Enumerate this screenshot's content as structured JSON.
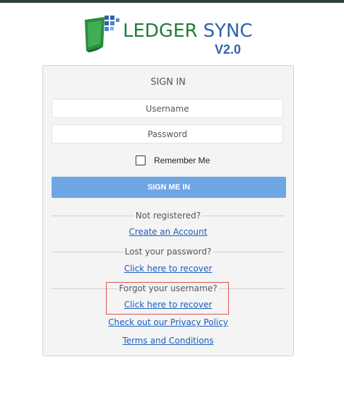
{
  "brand": {
    "name_part1": "LEDGER",
    "name_part2": "SYNC",
    "version": "V2.0",
    "colors": {
      "green": "#1f7c36",
      "blue": "#2f62b0"
    }
  },
  "login": {
    "title": "SIGN IN",
    "username_placeholder": "Username",
    "password_placeholder": "Password",
    "remember_label": "Remember Me",
    "submit_label": "SIGN ME IN",
    "submit_color": "#6ea6e3"
  },
  "links": {
    "not_registered": "Not registered?",
    "create_account": "Create an Account",
    "lost_password": "Lost your password?",
    "recover_password": "Click here to recover",
    "forgot_username": "Forgot your username?",
    "recover_username": "Click here to recover",
    "privacy_policy": "Check out our Privacy Policy",
    "terms": "Terms and Conditions",
    "link_color": "#1a5dbd"
  },
  "annotation": {
    "highlight_color": "#e05050"
  }
}
